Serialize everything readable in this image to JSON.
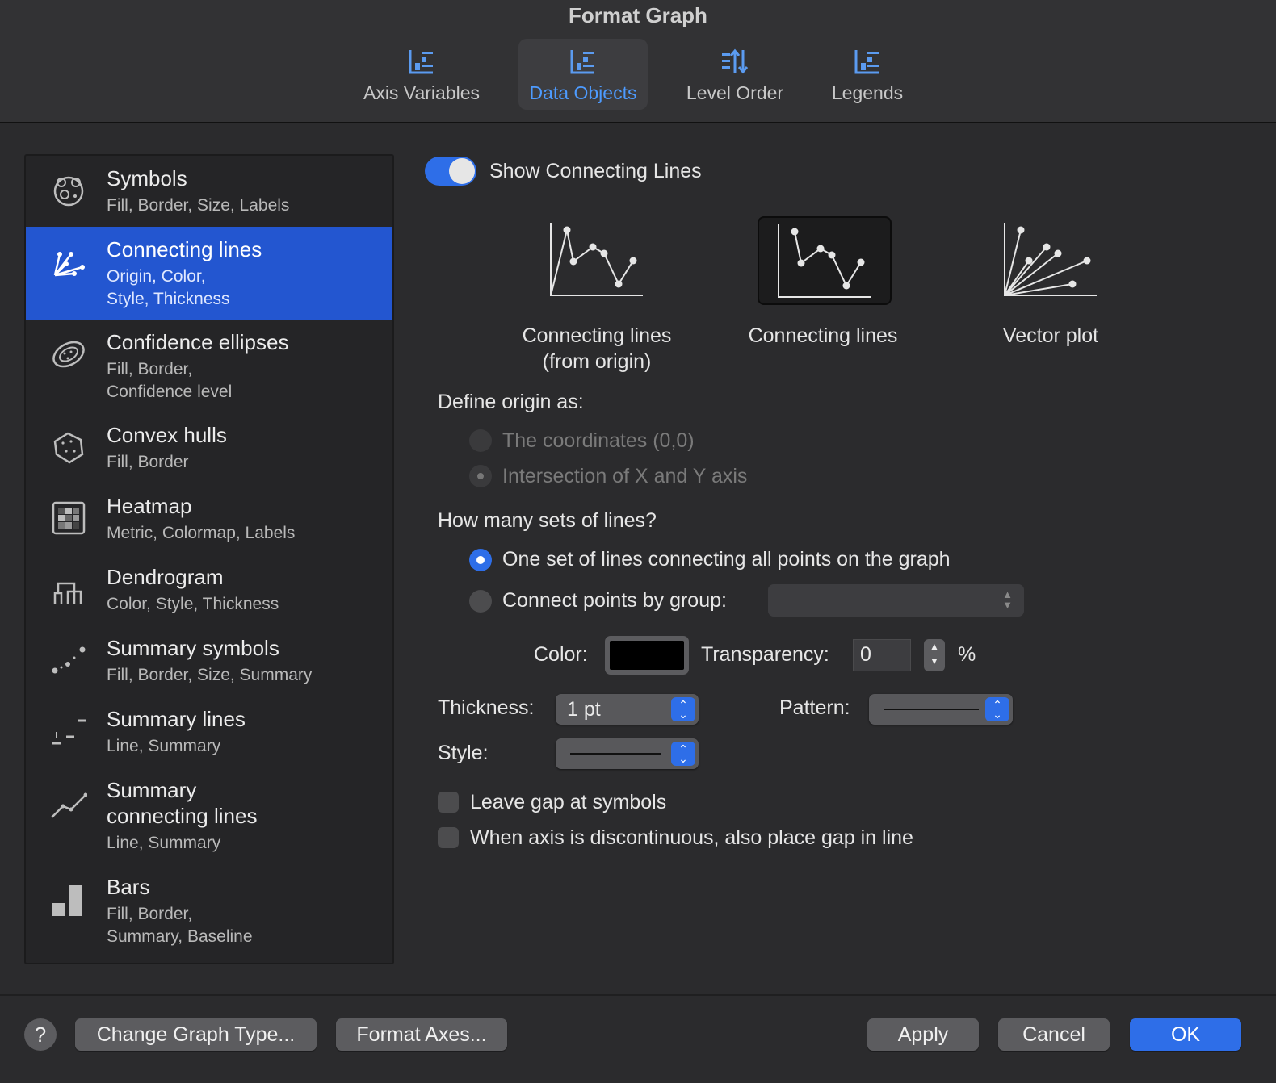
{
  "window": {
    "title": "Format Graph"
  },
  "tabs": [
    {
      "label": "Axis Variables",
      "icon": "axis-variables-icon"
    },
    {
      "label": "Data Objects",
      "icon": "data-objects-icon",
      "active": true
    },
    {
      "label": "Level Order",
      "icon": "level-order-icon"
    },
    {
      "label": "Legends",
      "icon": "legends-icon"
    }
  ],
  "sidebar": {
    "items": [
      {
        "title": "Symbols",
        "sub1": "Fill, Border, Size, Labels",
        "icon": "symbols-icon"
      },
      {
        "title": "Connecting lines",
        "sub1": "Origin, Color,",
        "sub2": "Style, Thickness",
        "icon": "connecting-lines-icon",
        "selected": true
      },
      {
        "title": "Confidence ellipses",
        "sub1": "Fill, Border,",
        "sub2": "Confidence level",
        "icon": "confidence-ellipses-icon"
      },
      {
        "title": "Convex hulls",
        "sub1": "Fill, Border",
        "icon": "convex-hulls-icon"
      },
      {
        "title": "Heatmap",
        "sub1": "Metric, Colormap, Labels",
        "icon": "heatmap-icon"
      },
      {
        "title": "Dendrogram",
        "sub1": "Color, Style, Thickness",
        "icon": "dendrogram-icon"
      },
      {
        "title": "Summary symbols",
        "sub1": "Fill, Border, Size, Summary",
        "icon": "summary-symbols-icon"
      },
      {
        "title": "Summary lines",
        "sub1": "Line, Summary",
        "icon": "summary-lines-icon"
      },
      {
        "title": "Summary",
        "title2": "connecting lines",
        "sub1": "Line, Summary",
        "icon": "summary-connecting-lines-icon"
      },
      {
        "title": "Bars",
        "sub1": "Fill, Border,",
        "sub2": "Summary, Baseline",
        "icon": "bars-icon"
      }
    ]
  },
  "panel": {
    "show_lines_label": "Show Connecting Lines",
    "show_lines_on": true,
    "choices": [
      {
        "line1": "Connecting lines",
        "line2": "(from origin)"
      },
      {
        "line1": "Connecting lines",
        "selected": true
      },
      {
        "line1": "Vector plot"
      }
    ],
    "define_origin_label": "Define origin as:",
    "origin_options": [
      {
        "label": "The coordinates (0,0)",
        "checked": false
      },
      {
        "label": "Intersection of X and Y axis",
        "checked": true
      }
    ],
    "sets_label": "How many sets of lines?",
    "sets_options": [
      {
        "label": "One set of lines connecting all points on the graph",
        "checked": true
      },
      {
        "label": "Connect points by group:",
        "checked": false
      }
    ],
    "color_label": "Color:",
    "color_value": "#000000",
    "transparency_label": "Transparency:",
    "transparency_value": "0",
    "percent_label": "%",
    "thickness_label": "Thickness:",
    "thickness_value": "1 pt",
    "pattern_label": "Pattern:",
    "style_label": "Style:",
    "leave_gap_label": "Leave gap at symbols",
    "discontinuous_label": "When axis is discontinuous, also place gap in line"
  },
  "footer": {
    "help_label": "?",
    "change_graph_type": "Change Graph Type...",
    "format_axes": "Format Axes...",
    "apply": "Apply",
    "cancel": "Cancel",
    "ok": "OK"
  },
  "colors": {
    "accent": "#2e6ee8",
    "selection": "#2356d0"
  }
}
